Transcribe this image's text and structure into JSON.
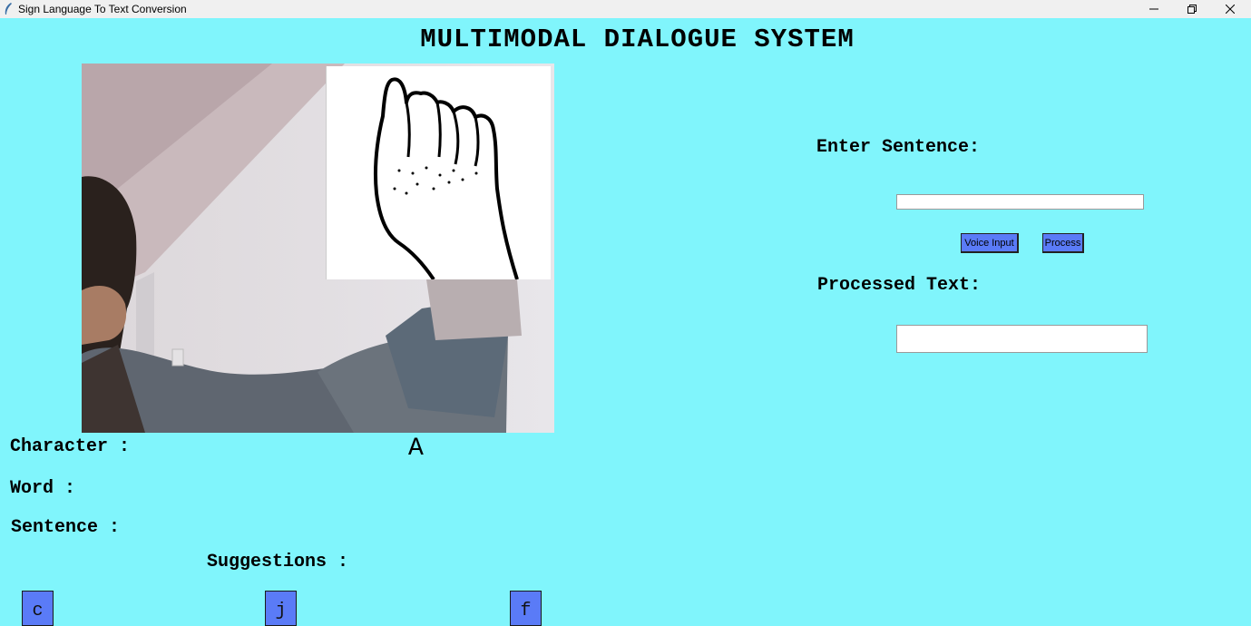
{
  "window": {
    "title": "Sign Language To Text Conversion",
    "controls": {
      "minimize_icon": "minimize-icon",
      "restore_icon": "restore-icon",
      "close_icon": "close-icon"
    }
  },
  "header": {
    "title": "MULTIMODAL DIALOGUE SYSTEM"
  },
  "left": {
    "character_label": "Character :",
    "character_value": "A",
    "word_label": "Word :",
    "word_value": "",
    "sentence_label": "Sentence :",
    "sentence_value": "",
    "suggestions_label": "Suggestions :",
    "suggestions": [
      "c",
      "j",
      "f"
    ]
  },
  "right": {
    "enter_label": "Enter Sentence:",
    "enter_value": "",
    "voice_button": "Voice Input",
    "process_button": "Process",
    "processed_label": "Processed Text:",
    "processed_value": ""
  },
  "colors": {
    "background": "#80f5fc",
    "button": "#5a7bf7"
  }
}
